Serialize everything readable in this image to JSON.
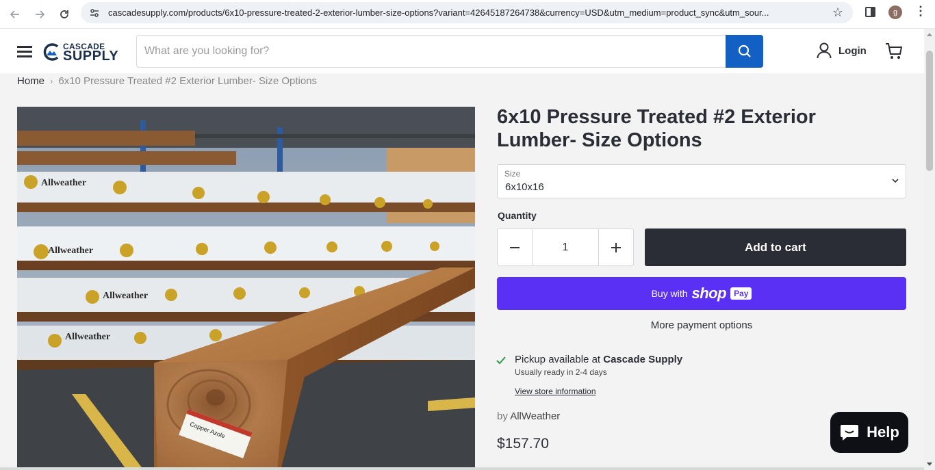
{
  "browser": {
    "url": "cascadesupply.com/products/6x10-pressure-treated-2-exterior-lumber-size-options?variant=42645187264738&currency=USD&utm_medium=product_sync&utm_sour...",
    "profile_initial": "g"
  },
  "header": {
    "logo_top": "CASCADE",
    "logo_bottom": "SUPPLY",
    "search_placeholder": "What are you looking for?",
    "login_label": "Login"
  },
  "breadcrumb": {
    "home": "Home",
    "separator": "›",
    "current": "6x10 Pressure Treated #2 Exterior Lumber- Size Options"
  },
  "product": {
    "title": "6x10 Pressure Treated #2 Exterior Lumber- Size Options",
    "size_label": "Size",
    "size_value": "6x10x16",
    "quantity_label": "Quantity",
    "quantity_value": "1",
    "add_to_cart": "Add to cart",
    "buy_with": "Buy with",
    "shop_word": "shop",
    "pay_badge": "Pay",
    "more_payment": "More payment options",
    "pickup_prefix": "Pickup available at",
    "pickup_store": "Cascade Supply",
    "pickup_ready": "Usually ready in 2-4 days",
    "store_info_link": "View store information",
    "vendor_prefix": "by",
    "vendor": "AllWeather",
    "price": "$157.70",
    "image_brand_text": "Allweather Wood",
    "tag_text": "Copper Azole"
  },
  "chat": {
    "help_label": "Help"
  },
  "colors": {
    "accent_blue": "#1260c4",
    "dark_button": "#2b2d36",
    "shop_purple": "#5a31f4",
    "check_green": "#2e9a4a"
  }
}
